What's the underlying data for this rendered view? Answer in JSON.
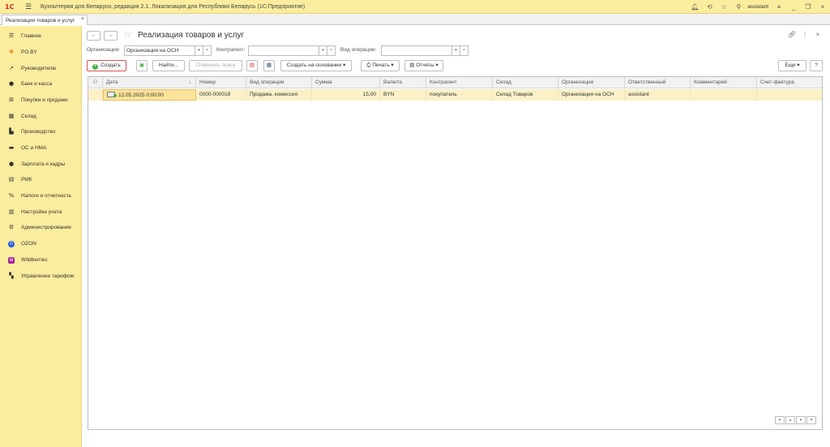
{
  "app": {
    "logo": "1С",
    "title": "Бухгалтерия для Беларуси, редакция 2.1. Локализация для Республики Беларусь",
    "platform": "(1С:Предприятие)",
    "user": "assistant"
  },
  "tabs": [
    {
      "label": "Реализация товаров и услуг",
      "close": "×"
    }
  ],
  "sidebar": {
    "items": [
      {
        "label": "Главное",
        "icon": "menu-icon"
      },
      {
        "label": "PO.BY",
        "icon": "sun-icon"
      },
      {
        "label": "Руководителю",
        "icon": "trend-icon"
      },
      {
        "label": "Банк и касса",
        "icon": "bank-icon"
      },
      {
        "label": "Покупки и продажи",
        "icon": "cart-icon"
      },
      {
        "label": "Склад",
        "icon": "warehouse-icon"
      },
      {
        "label": "Производство",
        "icon": "factory-icon"
      },
      {
        "label": "ОС и НМА",
        "icon": "truck-icon"
      },
      {
        "label": "Зарплата и кадры",
        "icon": "person-icon"
      },
      {
        "label": "РМК",
        "icon": "register-icon"
      },
      {
        "label": "Налоги и отчетность",
        "icon": "percent-icon"
      },
      {
        "label": "Настройки учета",
        "icon": "settings-doc-icon"
      },
      {
        "label": "Администрирование",
        "icon": "gear-icon"
      },
      {
        "label": "OZON",
        "icon": "ozon-icon"
      },
      {
        "label": "Wildberries",
        "icon": "wildberries-icon"
      },
      {
        "label": "Управление тарифом",
        "icon": "tariff-icon"
      }
    ]
  },
  "form": {
    "title": "Реализация товаров и услуг",
    "back": "←",
    "forward": "→"
  },
  "filters": {
    "org_label": "Организация:",
    "org_value": "Организация на ОСН",
    "counterparty_label": "Контрагент:",
    "counterparty_value": "",
    "op_label": "Вид операции:",
    "op_value": ""
  },
  "toolbar": {
    "create": "Создать",
    "find": "Найти...",
    "cancel_search": "Отменить поиск",
    "create_based": "Создать на основании",
    "print": "Печать",
    "reports": "Отчеты",
    "more": "Еще",
    "help": "?"
  },
  "table": {
    "columns": [
      "Дата",
      "Номер",
      "Вид операции",
      "Сумма",
      "Валюта",
      "Контрагент",
      "Склад",
      "Организация",
      "Ответственный",
      "Комментарий",
      "Счет-фактура"
    ],
    "rows": [
      {
        "date": "12.05.2025 0:00:00",
        "number": "0000-000018",
        "operation": "Продажа, комиссия",
        "sum": "15,00",
        "currency": "BYN",
        "counterparty": "покупатель",
        "warehouse": "Склад Товаров",
        "org": "Организация на ОСН",
        "responsible": "assistant",
        "comment": "",
        "invoice": ""
      }
    ]
  },
  "colors": {
    "sidebar_bg": "#FBED9E",
    "row_selected": "#FBF1C7",
    "create_border": "#D9534F"
  }
}
